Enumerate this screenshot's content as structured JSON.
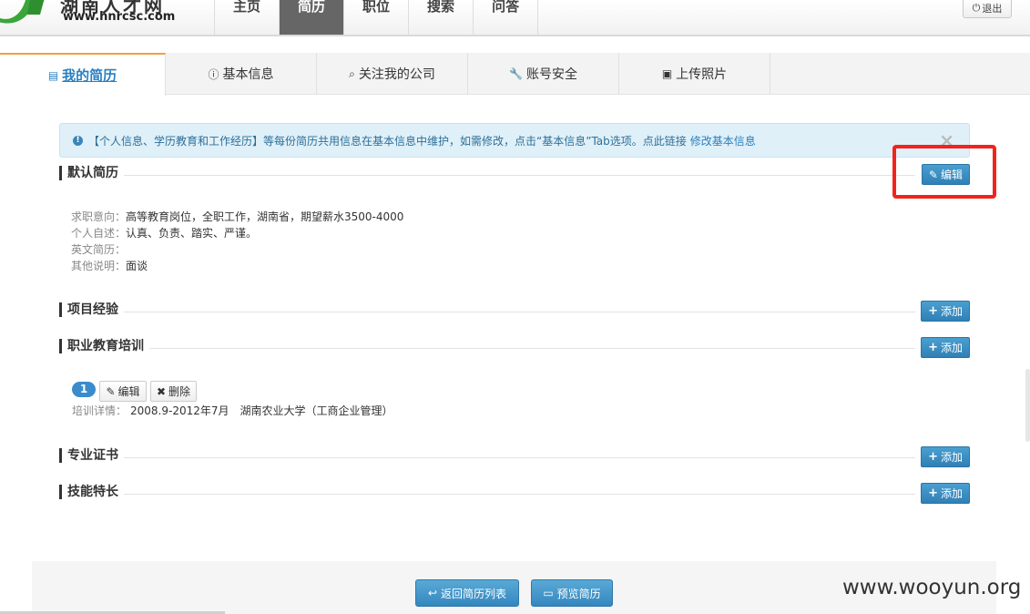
{
  "header": {
    "logo_cn": "湖南人才网",
    "logo_url": "www.hnrcsc.com",
    "nav": [
      "主页",
      "简历",
      "职位",
      "搜索",
      "问答"
    ],
    "active_nav_index": 1,
    "logout_label": "退出"
  },
  "tabs": [
    {
      "label": "我的简历",
      "icon": "file-icon",
      "active": true
    },
    {
      "label": "基本信息",
      "icon": "info-icon",
      "active": false
    },
    {
      "label": "关注我的公司",
      "icon": "search-icon",
      "active": false
    },
    {
      "label": "账号安全",
      "icon": "wrench-icon",
      "active": false
    },
    {
      "label": "上传照片",
      "icon": "image-icon",
      "active": false
    }
  ],
  "alert": {
    "text": "【个人信息、学历教育和工作经历】等每份简历共用信息在基本信息中维护，如需修改，点击“基本信息”Tab选项。点此链接",
    "link": "修改基本信息",
    "close": "×"
  },
  "sections": {
    "default_resume": {
      "title": "默认简历",
      "button": "编辑"
    },
    "project": {
      "title": "项目经验",
      "button": "添加"
    },
    "training": {
      "title": "职业教育培训",
      "button": "添加"
    },
    "cert": {
      "title": "专业证书",
      "button": "添加"
    },
    "skills": {
      "title": "技能特长",
      "button": "添加"
    }
  },
  "resume": {
    "intent_label": "求职意向：",
    "intent": "高等教育岗位，全职工作，湖南省，期望薪水3500-4000",
    "self_label": "个人自述：",
    "self": "认真、负责、踏实、严谨。",
    "english_label": "英文简历：",
    "english": "",
    "other_label": "其他说明：",
    "other": "面谈"
  },
  "training_item": {
    "number": "1",
    "edit": "编辑",
    "delete": "删除",
    "detail_label": "培训详情：",
    "detail": "2008.9-2012年7月　湖南农业大学（工商企业管理）"
  },
  "footer": {
    "back": "返回简历列表",
    "preview": "预览简历"
  },
  "watermark": "www.wooyun.org",
  "colors": {
    "accent": "#2f80b6",
    "highlight": "#f2231c",
    "tab_active_top": "#f0a040"
  }
}
